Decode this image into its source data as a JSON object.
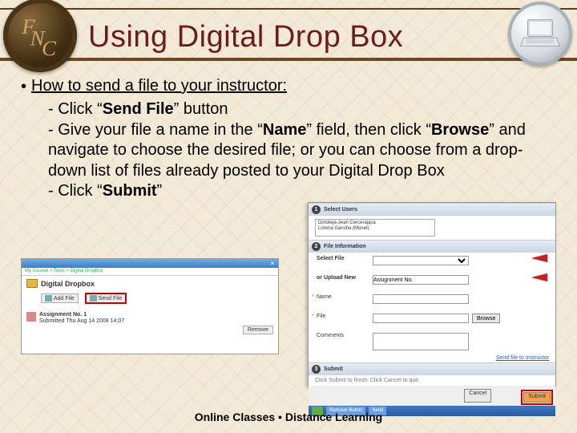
{
  "logo_text": "FNC",
  "title": "Using Digital Drop Box",
  "lead": "How to send a file to your instructor:",
  "steps": {
    "s1_pre": "- Click “",
    "s1_bold": "Send File",
    "s1_post": "” button",
    "s2a_pre": "- Give your file a name in the “",
    "s2a_bold": "Name",
    "s2a_mid": "” field, then click “",
    "s2a_bold2": "Browse",
    "s2a_post": "” and navigate to choose the desired file; or you can choose from a drop-down list of files already posted to your Digital Drop Box",
    "s3_pre": "- Click “",
    "s3_bold": "Submit",
    "s3_post": "”"
  },
  "shot_left": {
    "crumbs": "My Course > Tools > Digital Dropbox",
    "title": "Digital Dropbox",
    "add": "Add File",
    "send": "Send File",
    "assign_name": "Assignment No. 1",
    "assign_date": "Submitted Thu Aug 14 2008 14:07",
    "remove": "Remove"
  },
  "shot_right": {
    "n1": "1",
    "n2": "2",
    "n3": "3",
    "hd1": "Select Users",
    "user1": "Doroteja-Jean Cercerająca",
    "user2": "Lorena Gansha (Monet)",
    "hd2": "File Information",
    "lbl_select": "Select File",
    "lbl_or": "or Upload New",
    "lbl_name": "Name",
    "lbl_file": "File",
    "lbl_comments": "Comments",
    "upload_val": "Assignment No.",
    "browse": "Browse",
    "link": "Send file to Instructor",
    "hd3": "Submit",
    "submit_hint": "Click Submit to finish. Click Cancel to quit.",
    "cancel": "Cancel",
    "submit": "Submit",
    "task1": "Remove Button",
    "task2": "Send"
  },
  "footer": "Online Classes  •  Distance Learning"
}
